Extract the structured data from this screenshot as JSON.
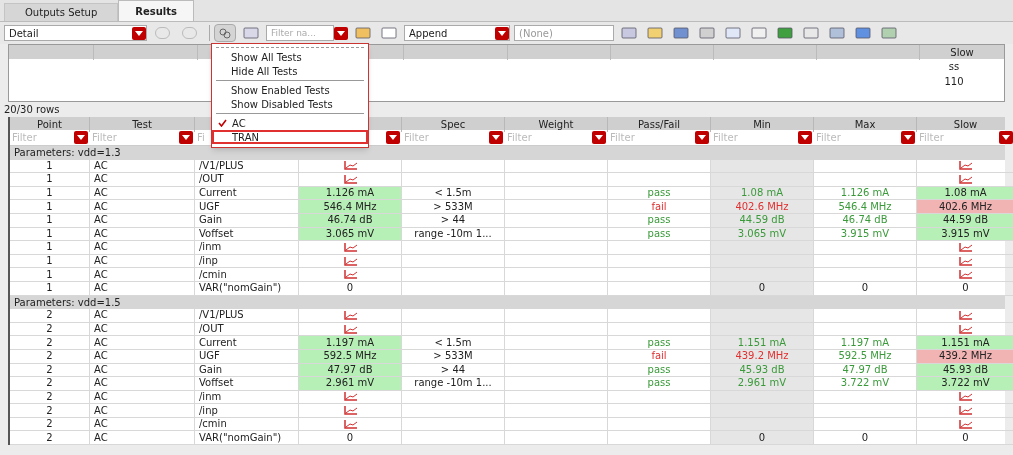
{
  "tabs": [
    {
      "label": "Outputs Setup",
      "selected": false
    },
    {
      "label": "Results",
      "selected": true
    }
  ],
  "toolbar": {
    "view_select": "Detail",
    "filter_field": {
      "placeholder": "Filter na..."
    },
    "append_select": "Append",
    "history_select": "(None)"
  },
  "menu": {
    "items": [
      {
        "kind": "item",
        "label": "Show All Tests"
      },
      {
        "kind": "item",
        "label": "Hide All Tests"
      },
      {
        "kind": "separator"
      },
      {
        "kind": "item",
        "label": "Show Enabled Tests"
      },
      {
        "kind": "item",
        "label": "Show Disabled Tests"
      },
      {
        "kind": "separator"
      },
      {
        "kind": "check",
        "label": "AC",
        "checked": true,
        "highlighted": false
      },
      {
        "kind": "check",
        "label": "TRAN",
        "checked": false,
        "highlighted": true
      }
    ]
  },
  "summary": {
    "column": "Slow",
    "values": [
      "ss",
      "110"
    ]
  },
  "row_count": "20/30 rows",
  "table": {
    "columns": [
      {
        "label": "Point",
        "placeholder": "Filter",
        "highlighted": false
      },
      {
        "label": "Test",
        "placeholder": "Filter",
        "highlighted": false
      },
      {
        "placeholder": "Fi",
        "highlighted": false
      },
      {
        "highlighted": false
      },
      {
        "label": "Spec",
        "placeholder": "Filter",
        "highlighted": false
      },
      {
        "label": "Weight",
        "placeholder": "Filter",
        "highlighted": false
      },
      {
        "label": "Pass/Fail",
        "placeholder": "Filter",
        "highlighted": false
      },
      {
        "label": "Min",
        "placeholder": "Filter",
        "highlighted": true
      },
      {
        "label": "Max",
        "placeholder": "Filter",
        "highlighted": false
      },
      {
        "label": "Slow",
        "placeholder": "Filter",
        "highlighted": false
      }
    ],
    "groups": [
      {
        "label": "Parameters: vdd=1.3",
        "rows": [
          [
            "1",
            "AC",
            "/V1/PLUS",
            {
              "kind": "plot"
            },
            null,
            null,
            null,
            null,
            null,
            {
              "kind": "plot"
            }
          ],
          [
            "1",
            "AC",
            "/OUT",
            {
              "kind": "plot"
            },
            null,
            null,
            null,
            null,
            null,
            {
              "kind": "plot"
            }
          ],
          [
            "1",
            "AC",
            "Current",
            {
              "kind": "value",
              "text": "1.126 mA",
              "passed": true
            },
            "< 1.5m",
            null,
            {
              "kind": "value",
              "text": "pass",
              "passed": true
            },
            {
              "kind": "value",
              "text": "1.08 mA",
              "passed": true
            },
            {
              "kind": "value",
              "text": "1.126 mA",
              "passed": true
            },
            {
              "kind": "value",
              "text": "1.08 mA",
              "passed": true
            }
          ],
          [
            "1",
            "AC",
            "UGF",
            {
              "kind": "value",
              "text": "546.4 MHz",
              "passed": true
            },
            "> 533M",
            null,
            {
              "kind": "value",
              "text": "fail",
              "passed": false
            },
            {
              "kind": "value",
              "text": "402.6 MHz",
              "passed": false
            },
            {
              "kind": "value",
              "text": "546.4 MHz",
              "passed": true
            },
            {
              "kind": "value",
              "text": "402.6 MHz",
              "passed": false
            }
          ],
          [
            "1",
            "AC",
            "Gain",
            {
              "kind": "value",
              "text": "46.74 dB",
              "passed": true
            },
            "> 44",
            null,
            {
              "kind": "value",
              "text": "pass",
              "passed": true
            },
            {
              "kind": "value",
              "text": "44.59 dB",
              "passed": true
            },
            {
              "kind": "value",
              "text": "46.74 dB",
              "passed": true
            },
            {
              "kind": "value",
              "text": "44.59 dB",
              "passed": true
            }
          ],
          [
            "1",
            "AC",
            "Voffset",
            {
              "kind": "value",
              "text": "3.065 mV",
              "passed": true
            },
            "range -10m 1...",
            null,
            {
              "kind": "value",
              "text": "pass",
              "passed": true
            },
            {
              "kind": "value",
              "text": "3.065 mV",
              "passed": true
            },
            {
              "kind": "value",
              "text": "3.915 mV",
              "passed": true
            },
            {
              "kind": "value",
              "text": "3.915 mV",
              "passed": true
            }
          ],
          [
            "1",
            "AC",
            "/inm",
            {
              "kind": "plot"
            },
            null,
            null,
            null,
            null,
            null,
            {
              "kind": "plot"
            }
          ],
          [
            "1",
            "AC",
            "/inp",
            {
              "kind": "plot"
            },
            null,
            null,
            null,
            null,
            null,
            {
              "kind": "plot"
            }
          ],
          [
            "1",
            "AC",
            "/cmin",
            {
              "kind": "plot"
            },
            null,
            null,
            null,
            null,
            null,
            {
              "kind": "plot"
            }
          ],
          [
            "1",
            "AC",
            "VAR(\"nomGain\")",
            "0",
            null,
            null,
            null,
            "0",
            "0",
            "0"
          ]
        ]
      },
      {
        "label": "Parameters: vdd=1.5",
        "rows": [
          [
            "2",
            "AC",
            "/V1/PLUS",
            {
              "kind": "plot"
            },
            null,
            null,
            null,
            null,
            null,
            {
              "kind": "plot"
            }
          ],
          [
            "2",
            "AC",
            "/OUT",
            {
              "kind": "plot"
            },
            null,
            null,
            null,
            null,
            null,
            {
              "kind": "plot"
            }
          ],
          [
            "2",
            "AC",
            "Current",
            {
              "kind": "value",
              "text": "1.197 mA",
              "passed": true
            },
            "< 1.5m",
            null,
            {
              "kind": "value",
              "text": "pass",
              "passed": true
            },
            {
              "kind": "value",
              "text": "1.151 mA",
              "passed": true
            },
            {
              "kind": "value",
              "text": "1.197 mA",
              "passed": true
            },
            {
              "kind": "value",
              "text": "1.151 mA",
              "passed": true
            }
          ],
          [
            "2",
            "AC",
            "UGF",
            {
              "kind": "value",
              "text": "592.5 MHz",
              "passed": true
            },
            "> 533M",
            null,
            {
              "kind": "value",
              "text": "fail",
              "passed": false
            },
            {
              "kind": "value",
              "text": "439.2 MHz",
              "passed": false
            },
            {
              "kind": "value",
              "text": "592.5 MHz",
              "passed": true
            },
            {
              "kind": "value",
              "text": "439.2 MHz",
              "passed": false
            }
          ],
          [
            "2",
            "AC",
            "Gain",
            {
              "kind": "value",
              "text": "47.97 dB",
              "passed": true
            },
            "> 44",
            null,
            {
              "kind": "value",
              "text": "pass",
              "passed": true
            },
            {
              "kind": "value",
              "text": "45.93 dB",
              "passed": true
            },
            {
              "kind": "value",
              "text": "47.97 dB",
              "passed": true
            },
            {
              "kind": "value",
              "text": "45.93 dB",
              "passed": true
            }
          ],
          [
            "2",
            "AC",
            "Voffset",
            {
              "kind": "value",
              "text": "2.961 mV",
              "passed": true
            },
            "range -10m 1...",
            null,
            {
              "kind": "value",
              "text": "pass",
              "passed": true
            },
            {
              "kind": "value",
              "text": "2.961 mV",
              "passed": true
            },
            {
              "kind": "value",
              "text": "3.722 mV",
              "passed": true
            },
            {
              "kind": "value",
              "text": "3.722 mV",
              "passed": true
            }
          ],
          [
            "2",
            "AC",
            "/inm",
            {
              "kind": "plot"
            },
            null,
            null,
            null,
            null,
            null,
            {
              "kind": "plot"
            }
          ],
          [
            "2",
            "AC",
            "/inp",
            {
              "kind": "plot"
            },
            null,
            null,
            null,
            null,
            null,
            {
              "kind": "plot"
            }
          ],
          [
            "2",
            "AC",
            "/cmin",
            {
              "kind": "plot"
            },
            null,
            null,
            null,
            null,
            null,
            {
              "kind": "plot"
            }
          ],
          [
            "2",
            "AC",
            "VAR(\"nomGain\")",
            "0",
            null,
            null,
            null,
            "0",
            "0",
            "0"
          ]
        ]
      }
    ]
  }
}
